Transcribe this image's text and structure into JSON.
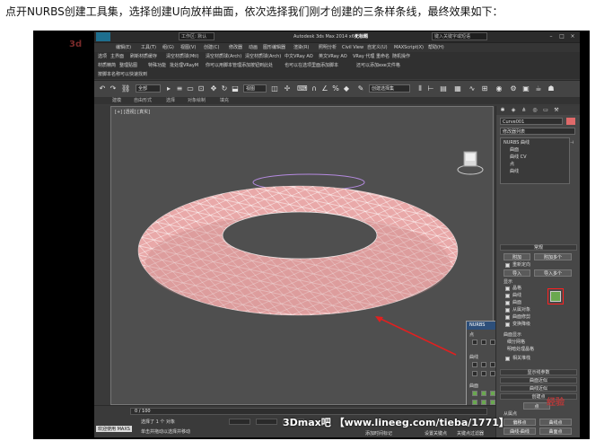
{
  "caption": "点开NURBS创建工具集，选择创建U向放样曲面，依次选择我们刚才创建的三条样条线，最终效果如下：",
  "titlebar": {
    "workspace": "工作区: 默认",
    "app_title": "Autodesk 3ds Max  2014 x64",
    "file_title": "无标题",
    "search_placeholder": "键入关键字或短语"
  },
  "menus": {
    "row1": [
      "编辑(E)",
      "工具(T)",
      "组(G)",
      "视图(V)",
      "创建(C)",
      "修改器",
      "动画",
      "图形编辑器",
      "渲染(R)",
      "照明分析",
      "Civil View",
      "自定义(U)",
      "MAXScript(X)",
      "帮助(H)"
    ],
    "row2": [
      "选项",
      "主界面",
      "刷新材质缓存",
      "清空材质球(Mtl)",
      "清空材质球(Arch)",
      "清空材质球(Arch)",
      "中文VRay AO",
      "英文VRay AO",
      "VRay 代理",
      "重命名",
      "随机操作"
    ],
    "row3": [
      "材质精简",
      "整理贴图",
      "特殊功能",
      "批处理VRayM",
      "你可以用脚本管理添加按钮到此处",
      "也可以在选项里面添加脚本",
      "还可以添加exe文件格"
    ],
    "row4": [
      "按脚本名称可以快速找到"
    ]
  },
  "toolbar": {
    "filter": "全部",
    "view": "视图",
    "selection_set": "创建选择集"
  },
  "viewport": {
    "label": "[+] [透视] [真实]"
  },
  "command_panel": {
    "object_name": "Curve001",
    "modifier_list": "修改器列表",
    "stack_root": "NURBS 曲线",
    "stack_items": [
      "曲面",
      "曲线 CV",
      "点",
      "曲线"
    ],
    "rollout_general": "常规",
    "btn_attach": "附加",
    "btn_attach_multi": "附加多个",
    "chk_reorient": "重新定向",
    "btn_import": "导入",
    "btn_import_multi": "导入多个",
    "display_title": "显示",
    "display_items": [
      "晶格",
      "曲线",
      "曲面",
      "从属对象",
      "曲面修剪",
      "变换降级"
    ],
    "surface_display": "曲面显示",
    "radio_tess": "细分网格",
    "radio_shaded": "明暗处理晶格",
    "chk_relational": "相关堆栈",
    "rollout_approx": "显示线参数",
    "rollout_surface_approx": "曲面近似",
    "rollout_curve_approx": "曲线近似",
    "rollout_create_points": "创建点",
    "point_label": "点",
    "btn_offset_point": "偏移点",
    "btn_curve_point": "曲线点",
    "btn_curve_curve": "曲线-曲线",
    "btn_surface_point": "曲面点",
    "btn_surface_curve": "曲面-曲线",
    "slave_points": "从属点"
  },
  "nurbs_toolbox": {
    "title": "NURBS",
    "sections": [
      "点",
      "曲线",
      "曲面"
    ]
  },
  "status": {
    "frame": "0 / 100",
    "selection": "选择了 1 个 对象",
    "hint": "单击并拖动以选择并移动",
    "welcome": "欢迎使用 MAXS",
    "add_time_tag": "添加时间标记",
    "auto_key": "设置关键点",
    "key_filter": "关键点过滤器"
  },
  "watermarks": {
    "bottom": "3Dmax吧 【www.lineeg.com/tieba/1771】",
    "corner_left": "3d",
    "corner_right": "经验"
  },
  "colors": {
    "torus": "#e9a9a9",
    "highlight": "#ff2020",
    "accent_blue": "#2d4f7a"
  }
}
